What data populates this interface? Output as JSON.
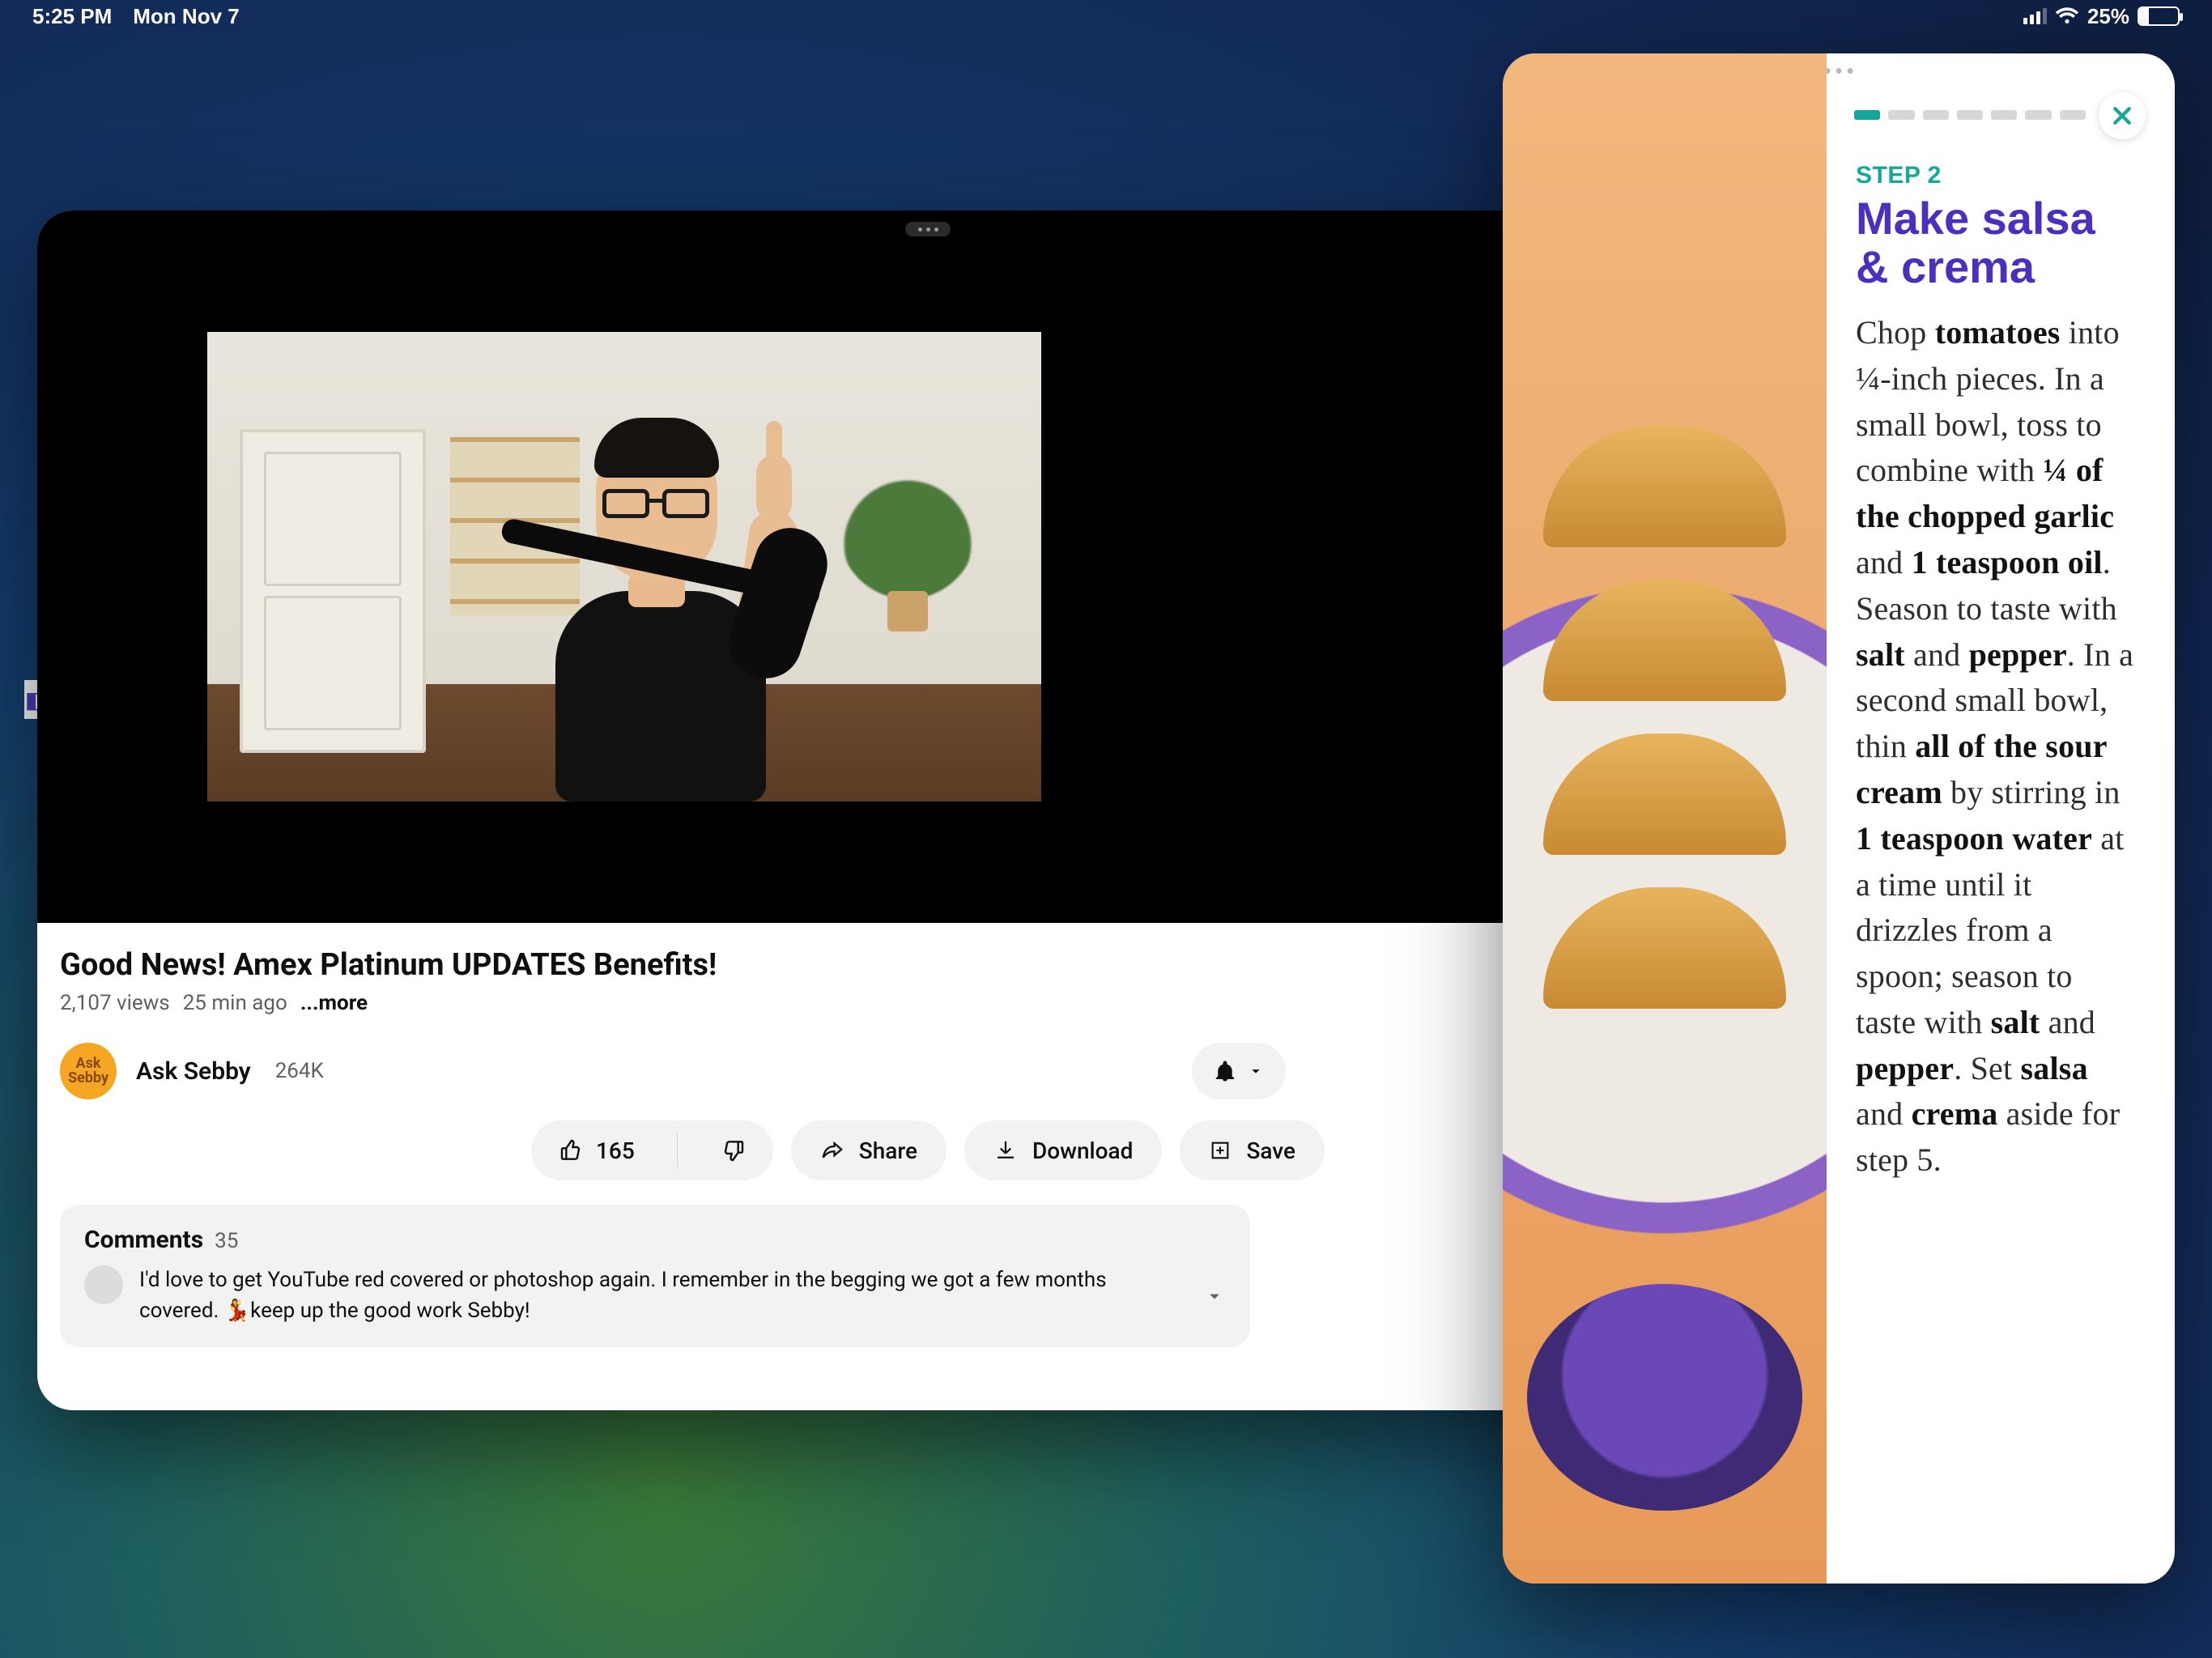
{
  "status": {
    "time": "5:25 PM",
    "date": "Mon Nov 7",
    "battery_pct": "25%"
  },
  "youtube": {
    "title": "Good News! Amex Platinum UPDATES Benefits!",
    "views": "2,107 views",
    "age": "25 min ago",
    "more": "...more",
    "channel": {
      "name": "Ask Sebby",
      "subs": "264K",
      "avatar_text": "Ask\nSebby"
    },
    "actions": {
      "like_count": "165",
      "share": "Share",
      "download": "Download",
      "save": "Save"
    },
    "comments": {
      "label": "Comments",
      "count": "35",
      "featured": "I'd love to get YouTube red covered or photoshop again. I remember in the begging we got a few months covered. 💃keep up the good work Sebby!"
    }
  },
  "recipe": {
    "step_label": "STEP 2",
    "title": "Make salsa & crema",
    "body_html": "Chop <b>tomatoes</b> into ¼-inch pieces. In a small bowl, toss to combine with <b>¼ of the chopped garlic</b> and <b>1 teaspoon oil</b>. Season to taste with <b>salt</b> and <b>pepper</b>. In a second small bowl, thin <b>all of the sour cream</b> by stirring in <b>1 teaspoon water</b> at a time until it drizzles from a spoon; season to taste with <b>salt</b> and <b>pepper</b>. Set <b>salsa</b> and <b>crema</b> aside for step 5.",
    "progress_total": 7,
    "progress_done": 1
  }
}
